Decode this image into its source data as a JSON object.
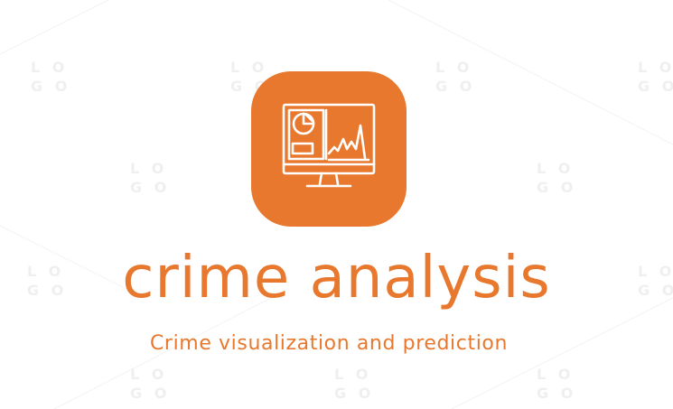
{
  "brand": {
    "name": "crime analysis",
    "tagline": "Crime visualization and prediction"
  },
  "watermark": {
    "text": "LOGO"
  },
  "colors": {
    "accent": "#e8782e",
    "background": "#ffffff",
    "icon_stroke": "#ffffff"
  },
  "icon": {
    "name": "monitor-analytics-icon"
  }
}
